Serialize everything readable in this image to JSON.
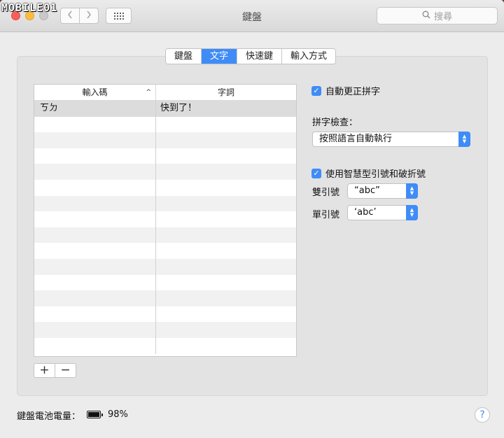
{
  "watermark": "MOBILE01",
  "window": {
    "title": "鍵盤",
    "search_placeholder": "搜尋",
    "back_icon": "chevron-left-icon",
    "forward_icon": "chevron-right-icon",
    "show_all_icon": "grid-icon"
  },
  "tabs": [
    {
      "label": "鍵盤",
      "active": false
    },
    {
      "label": "文字",
      "active": true
    },
    {
      "label": "快速鍵",
      "active": false
    },
    {
      "label": "輸入方式",
      "active": false
    }
  ],
  "table": {
    "col1_header": "輸入碼",
    "col2_header": "字詞",
    "sort_indicator": "^",
    "rows": [
      {
        "code": "ㄎㄉ",
        "phrase": "快到了！"
      }
    ],
    "add_label": "+",
    "remove_label": "−"
  },
  "options": {
    "autocorrect": {
      "label": "自動更正拼字",
      "checked": true
    },
    "spelling_label": "拼字檢查：",
    "spelling_value": "按照語言自動執行",
    "smart_quotes": {
      "label": "使用智慧型引號和破折號",
      "checked": true
    },
    "double_label": "雙引號",
    "double_value": "“abc”",
    "single_label": "單引號",
    "single_value": "‘abc’"
  },
  "footer": {
    "battery_label": "鍵盤電池電量：",
    "battery_percent": "98%",
    "battery_level": 0.98,
    "help_label": "?"
  },
  "colors": {
    "accent": "#3f8cf7"
  }
}
